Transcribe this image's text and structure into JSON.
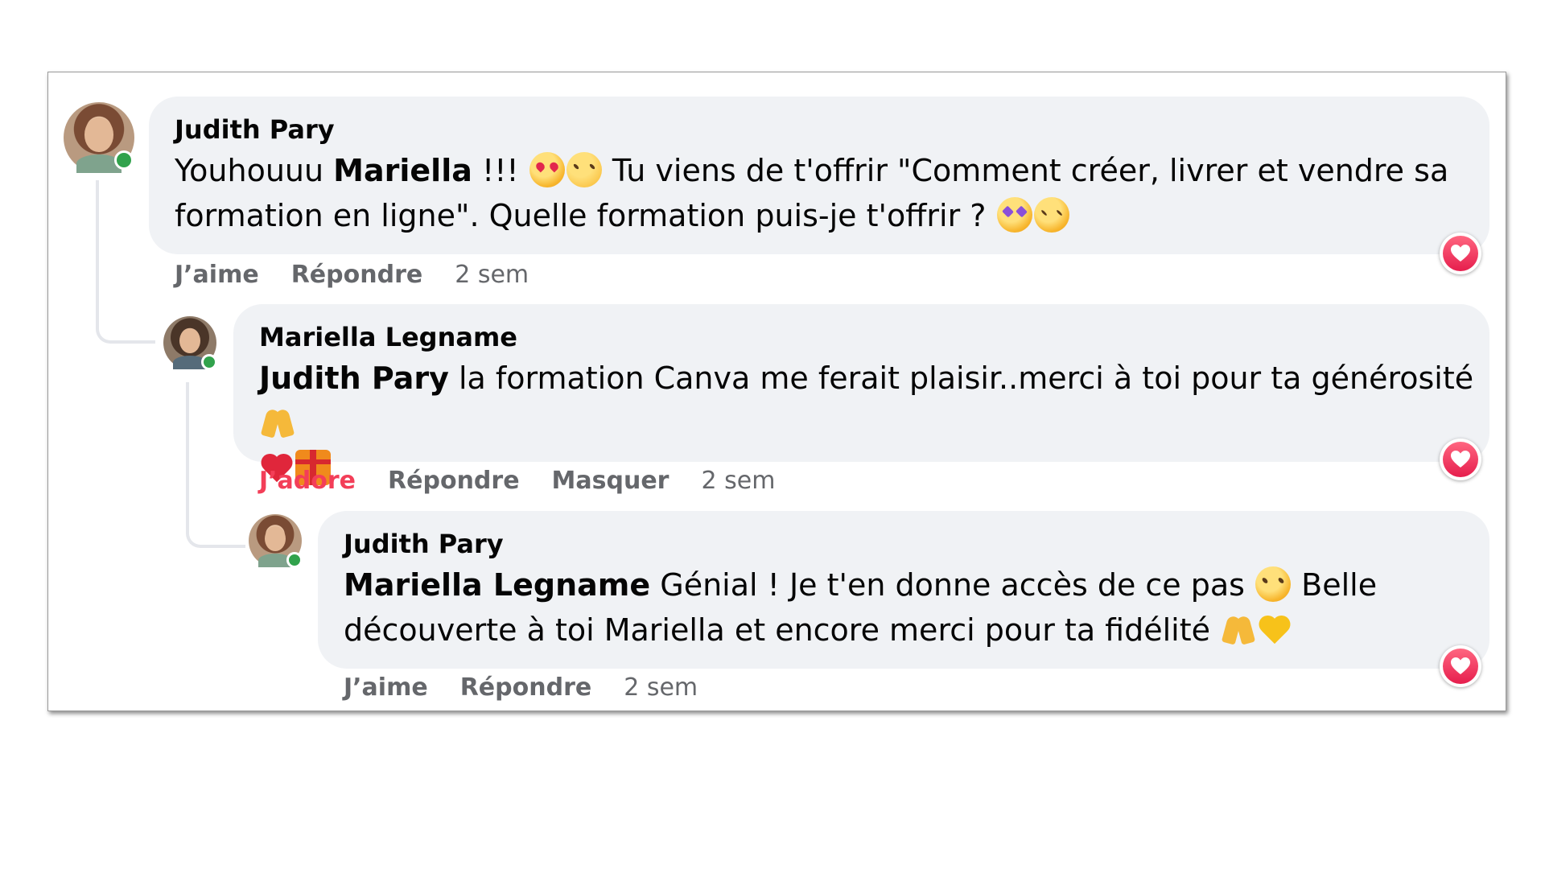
{
  "comments": [
    {
      "author": "Judith Pary",
      "line1": {
        "pre": "Youhouuu ",
        "mention": "Mariella",
        "post": " !!! ",
        "post2": " Tu viens de t'offrir \"Comment créer, livrer et vendre sa"
      },
      "line2": "formation en ligne\". Quelle formation puis-je t'offrir ? ",
      "actions": {
        "like": "J’aime",
        "reply": "Répondre",
        "time": "2 sem"
      }
    },
    {
      "author": "Mariella Legname",
      "line1": {
        "mention": "Judith Pary",
        "post": " la formation Canva me ferait plaisir..merci à toi pour ta générosité "
      },
      "actions": {
        "like": "J’adore",
        "reply": "Répondre",
        "hide": "Masquer",
        "time": "2 sem"
      }
    },
    {
      "author": "Judith Pary",
      "line1": {
        "mention": "Mariella Legname",
        "post": " Génial ! Je t'en donne accès de ce pas ",
        "post2": " Belle"
      },
      "line2": "découverte à toi Mariella et encore merci pour ta fidélité ",
      "actions": {
        "like": "J’aime",
        "reply": "Répondre",
        "time": "2 sem"
      }
    }
  ],
  "emojis": [
    "heart-eyes-emoji",
    "partying-face-emoji",
    "star-struck-emoji",
    "smiling-hearts-emoji",
    "folded-hands-emoji",
    "red-heart-emoji",
    "gift-emoji",
    "winking-face-emoji",
    "yellow-heart-emoji"
  ],
  "colors": {
    "bubble": "#f0f2f5",
    "loved": "#f33e58",
    "online": "#31a24c",
    "meta": "#65676b"
  }
}
